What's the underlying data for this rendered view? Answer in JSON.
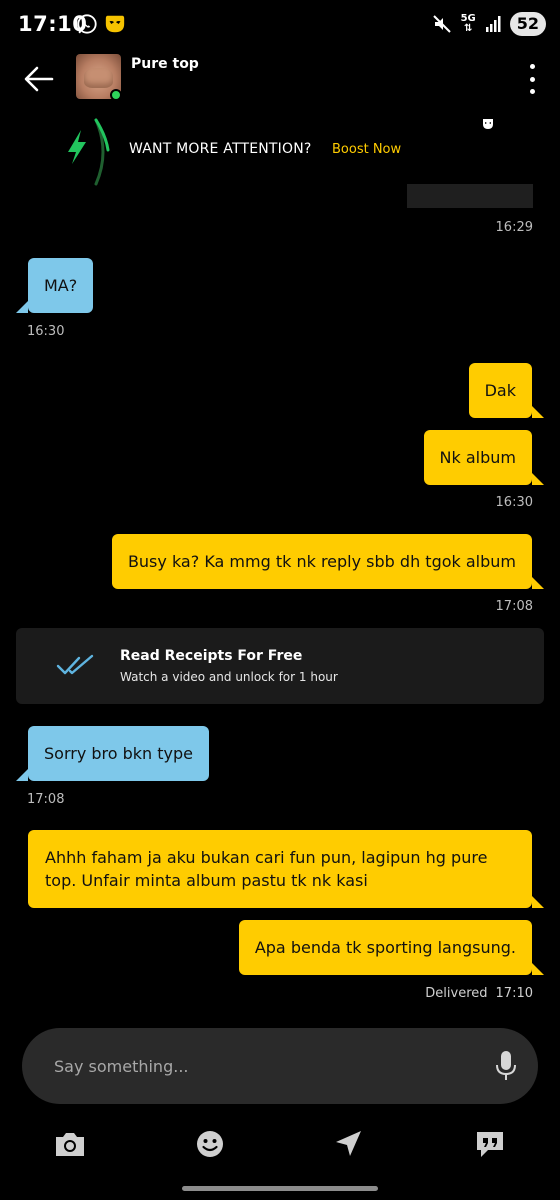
{
  "status_bar": {
    "time": "17:10",
    "network": "5G",
    "battery": "52"
  },
  "header": {
    "contact_name": "Pure top"
  },
  "boost": {
    "text": "WANT MORE ATTENTION?",
    "link": "Boost Now"
  },
  "messages": [
    {
      "direction": "out",
      "redacted": true,
      "time": "16:29"
    },
    {
      "direction": "in",
      "text": "MA?",
      "time": "16:30"
    },
    {
      "direction": "out",
      "text": "Dak"
    },
    {
      "direction": "out",
      "text": "Nk album",
      "time": "16:30"
    },
    {
      "direction": "out",
      "text": "Busy ka? Ka mmg tk nk reply sbb dh tgok album",
      "time": "17:08"
    },
    {
      "direction": "in",
      "text": "Sorry bro bkn type",
      "time": "17:08"
    },
    {
      "direction": "out",
      "text": "Ahhh faham ja aku bukan cari fun pun, lagipun hg pure top. Unfair minta album pastu tk nk kasi"
    },
    {
      "direction": "out",
      "text": "Apa benda tk sporting langsung.",
      "status": "Delivered",
      "time": "17:10"
    }
  ],
  "receipts_promo": {
    "title": "Read Receipts For Free",
    "subtitle": "Watch a video and unlock for 1 hour"
  },
  "composer": {
    "placeholder": "Say something..."
  },
  "toolbar": {
    "items": [
      "camera-icon",
      "emoji-icon",
      "location-icon",
      "quick-reply-icon"
    ]
  },
  "colors": {
    "incoming": "#7ec8ea",
    "outgoing": "#ffcc00",
    "accent": "#ffcc00",
    "background": "#000000",
    "online": "#2fd35a",
    "boost_bolt": "#22c55e"
  }
}
